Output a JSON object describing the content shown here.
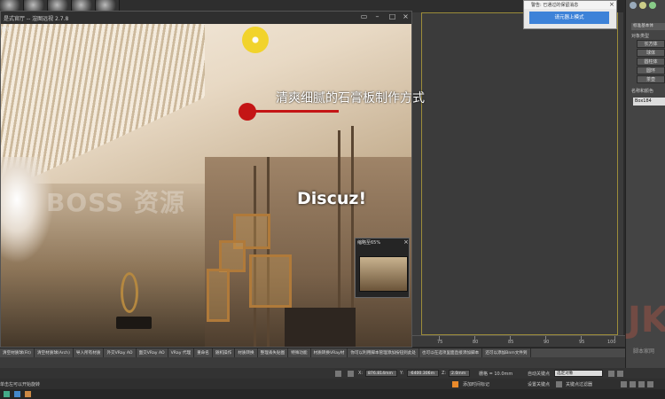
{
  "render_window": {
    "title": "是式官厅 -- 渲图远视 2.7.8",
    "corner_label": "管行"
  },
  "annotation": {
    "text": "清爽细腻的石膏板制作方式"
  },
  "watermarks": {
    "discuz": "Discuz!",
    "boss": "BOSS 资源",
    "logo": "JK",
    "logo_sub": "脚本家网"
  },
  "dialog": {
    "title": "警告: 已通过的保留消息",
    "button": "请元器上模式"
  },
  "mini_preview": {
    "title": "缩略至65%"
  },
  "command_panel": {
    "dropdown": "标准基本体",
    "section": "对象类型",
    "buttons": [
      "长方体",
      "球体",
      "圆柱体",
      "圆环",
      "茶壶"
    ],
    "name_label": "名称和颜色",
    "name_value": "Box184"
  },
  "timeline": {
    "ticks": [
      "75",
      "80",
      "85",
      "90",
      "95",
      "100"
    ]
  },
  "plugins": [
    "清空材质球(Fit)",
    "清空材质球(Arch)",
    "导入所有材质",
    "外交VRay AO",
    "面交VRay AO",
    "VRay 代理",
    "重命名",
    "随机操作",
    "材质转换",
    "整理丢失贴图",
    "特殊功能",
    "材质转换VRay材",
    "你可以利用脚本管理添加按钮到此处",
    "也可以在选项里面直接添加脚本",
    "还可以添加Bnm文件到"
  ],
  "status": {
    "left_text": "单击左可以开始旋转",
    "x_label": "X:",
    "x_value": "876.814mm",
    "y_label": "Y:",
    "y_value": "-6400.306m",
    "z_label": "Z:",
    "z_value": "2.0mm",
    "grid_label": "栅格 = 10.0mm",
    "autokey_label": "自动关键点",
    "setkey_label": "设置关键点",
    "selection_value": "选定对象",
    "filter_label": "关键点过滤器",
    "add_time_tag": "添加时间标记"
  },
  "colors": {
    "annotation_red": "#c41515",
    "cursor_yellow": "#f2d21a",
    "dialog_blue": "#3d82d8",
    "viewport_border": "#9c8c3a"
  }
}
